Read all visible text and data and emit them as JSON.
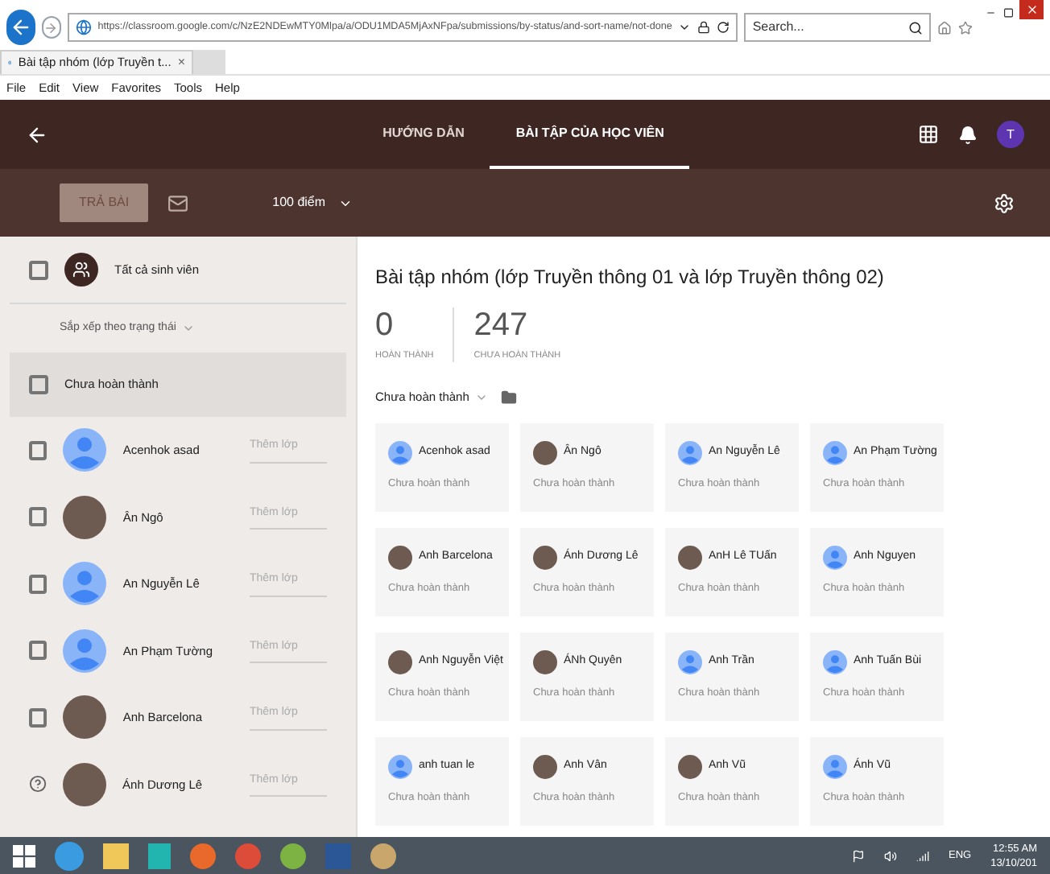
{
  "browser": {
    "url": "https://classroom.google.com/c/NzE2NDEwMTY0Mlpa/a/ODU1MDA5MjAxNFpa/submissions/by-status/and-sort-name/not-done",
    "search": {
      "placeholder": "Search..."
    },
    "tab": {
      "title": "Bài tập nhóm (lớp Truyền t...",
      "close": "×"
    },
    "menu": [
      "File",
      "Edit",
      "View",
      "Favorites",
      "Tools",
      "Help"
    ]
  },
  "header": {
    "tabs": [
      {
        "label": "HƯỚNG DẪN",
        "selected": false
      },
      {
        "label": "BÀI TẬP CỦA HỌC VIÊN",
        "selected": true
      }
    ],
    "avatar": "T"
  },
  "toolbar": {
    "return_button": {
      "label": "TRẢ BÀI",
      "disabled": true
    },
    "points": "100 điểm"
  },
  "sidebar": {
    "all_students": {
      "label": "Tất cả sinh viên",
      "checked": false
    },
    "sort": "Sắp xếp theo trạng thái",
    "group": {
      "label": "Chưa hoàn thành",
      "checked": false
    },
    "students": [
      {
        "name": "Acenhok asad",
        "kind": "default",
        "checked": false,
        "help": false,
        "class_placeholder": "Thêm lớp"
      },
      {
        "name": "Ân Ngô",
        "kind": "photo",
        "checked": false,
        "help": false,
        "class_placeholder": "Thêm lớp"
      },
      {
        "name": "An Nguyễn Lê",
        "kind": "default",
        "checked": false,
        "help": false,
        "class_placeholder": "Thêm lớp"
      },
      {
        "name": "An Phạm Tường",
        "kind": "default",
        "checked": false,
        "help": false,
        "class_placeholder": "Thêm lớp"
      },
      {
        "name": "Anh Barcelona",
        "kind": "photo",
        "checked": false,
        "help": false,
        "class_placeholder": "Thêm lớp"
      },
      {
        "name": "Ánh Dương Lê",
        "kind": "photo",
        "help": true,
        "class_placeholder": "Thêm lớp"
      }
    ]
  },
  "main": {
    "title": "Bài tập nhóm (lớp Truyền thông 01 và lớp Truyền thông 02)",
    "stats": [
      {
        "value": "0",
        "label": "HOÀN THÀNH"
      },
      {
        "value": "247",
        "label": "CHƯA HOÀN THÀNH"
      }
    ],
    "filter": "Chưa hoàn thành",
    "cards": [
      {
        "name": "Acenhok asad",
        "kind": "default",
        "status": "Chưa hoàn thành"
      },
      {
        "name": "Ân Ngô",
        "kind": "photo",
        "status": "Chưa hoàn thành"
      },
      {
        "name": "An Nguyễn Lê",
        "kind": "default",
        "status": "Chưa hoàn thành"
      },
      {
        "name": "An Phạm Tường",
        "kind": "default",
        "status": "Chưa hoàn thành"
      },
      {
        "name": "Anh Barcelona",
        "kind": "photo",
        "status": "Chưa hoàn thành"
      },
      {
        "name": "Ánh Dương Lê",
        "kind": "photo",
        "status": "Chưa hoàn thành"
      },
      {
        "name": "AnH Lê TUấn",
        "kind": "photo",
        "status": "Chưa hoàn thành"
      },
      {
        "name": "Anh Nguyen",
        "kind": "default",
        "status": "Chưa hoàn thành"
      },
      {
        "name": "Anh Nguyễn Việt",
        "kind": "photo",
        "status": "Chưa hoàn thành"
      },
      {
        "name": "ÁNh Quyên",
        "kind": "photo",
        "status": "Chưa hoàn thành"
      },
      {
        "name": "Anh Trần",
        "kind": "default",
        "status": "Chưa hoàn thành"
      },
      {
        "name": "Anh Tuấn Bùi",
        "kind": "default",
        "status": "Chưa hoàn thành"
      },
      {
        "name": "anh tuan le",
        "kind": "default",
        "status": "Chưa hoàn thành"
      },
      {
        "name": "Anh Vân",
        "kind": "photo",
        "status": "Chưa hoàn thành"
      },
      {
        "name": "Anh Vũ",
        "kind": "photo",
        "status": "Chưa hoàn thành"
      },
      {
        "name": "Ánh Vũ",
        "kind": "default",
        "status": "Chưa hoàn thành"
      }
    ]
  },
  "taskbar": {
    "language": "ENG",
    "time": "12:55 AM",
    "date": "13/10/201"
  }
}
